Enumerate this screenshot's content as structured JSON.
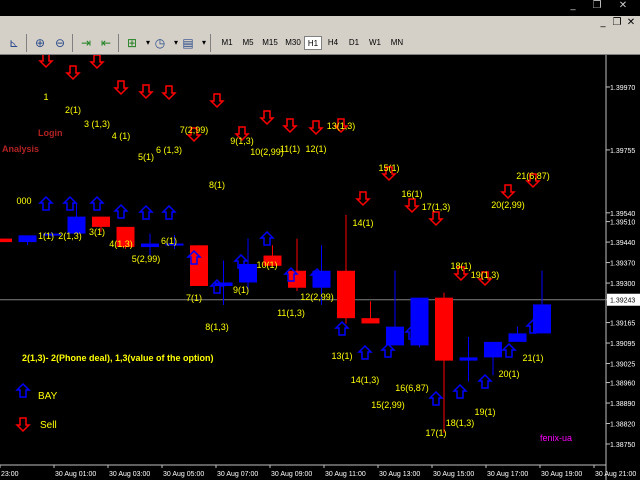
{
  "window_controls": {
    "minimize": "_",
    "restore": "❐",
    "close": "✕"
  },
  "toolbar": {
    "timeframes": [
      "M1",
      "M5",
      "M15",
      "M30",
      "H1",
      "H4",
      "D1",
      "W1",
      "MN"
    ],
    "active_timeframe": "H1"
  },
  "chart_data": {
    "type": "candlestick",
    "colors": {
      "bull": "#0000ff",
      "bear": "#ff0000",
      "up_arrow": "#0000ff",
      "down_arrow": "#ff0000",
      "labels": "#ffff00",
      "grid": "#404040",
      "current_price_line": "#808080"
    },
    "price_axis": {
      "ticks": [
        "1.39970",
        "1.39755",
        "1.39540",
        "1.39510",
        "1.39440",
        "1.39370",
        "1.39300",
        "1.39243",
        "1.39165",
        "1.39095",
        "1.39025",
        "1.38960",
        "1.38890",
        "1.38820",
        "1.38750"
      ],
      "current_price": "1.39243"
    },
    "time_axis": [
      "23:00",
      "30 Aug 01:00",
      "30 Aug 03:00",
      "30 Aug 05:00",
      "30 Aug 07:00",
      "30 Aug 09:00",
      "30 Aug 11:00",
      "30 Aug 13:00",
      "30 Aug 15:00",
      "30 Aug 17:00",
      "30 Aug 19:00",
      "30 Aug 21:00"
    ],
    "candles": [
      {
        "o": 1.39452,
        "h": 1.39452,
        "l": 1.3944,
        "c": 1.3944
      },
      {
        "o": 1.3944,
        "h": 1.39463,
        "l": 1.3943,
        "c": 1.39463
      },
      {
        "o": 1.39463,
        "h": 1.39475,
        "l": 1.39458,
        "c": 1.39469
      },
      {
        "o": 1.39469,
        "h": 1.39573,
        "l": 1.39469,
        "c": 1.39527
      },
      {
        "o": 1.39527,
        "h": 1.39527,
        "l": 1.39475,
        "c": 1.39492
      },
      {
        "o": 1.39492,
        "h": 1.39492,
        "l": 1.39417,
        "c": 1.39423
      },
      {
        "o": 1.39423,
        "h": 1.39469,
        "l": 1.39394,
        "c": 1.39435
      },
      {
        "o": 1.39435,
        "h": 1.39464,
        "l": 1.39417,
        "c": 1.39435
      },
      {
        "o": 1.39429,
        "h": 1.39429,
        "l": 1.3929,
        "c": 1.3929
      },
      {
        "o": 1.3929,
        "h": 1.39377,
        "l": 1.39226,
        "c": 1.39302
      },
      {
        "o": 1.39302,
        "h": 1.39452,
        "l": 1.39267,
        "c": 1.39365
      },
      {
        "o": 1.39394,
        "h": 1.39429,
        "l": 1.39365,
        "c": 1.39359
      },
      {
        "o": 1.39342,
        "h": 1.39452,
        "l": 1.39273,
        "c": 1.39284
      },
      {
        "o": 1.39284,
        "h": 1.39429,
        "l": 1.39226,
        "c": 1.39342
      },
      {
        "o": 1.39342,
        "h": 1.39533,
        "l": 1.39162,
        "c": 1.3918
      },
      {
        "o": 1.3918,
        "h": 1.39238,
        "l": 1.39162,
        "c": 1.39162
      },
      {
        "o": 1.39087,
        "h": 1.39342,
        "l": 1.39087,
        "c": 1.39151
      },
      {
        "o": 1.39087,
        "h": 1.3925,
        "l": 1.3908,
        "c": 1.3925
      },
      {
        "o": 1.3925,
        "h": 1.39267,
        "l": 1.38788,
        "c": 1.39035
      },
      {
        "o": 1.39035,
        "h": 1.39116,
        "l": 1.38963,
        "c": 1.39046
      },
      {
        "o": 1.39046,
        "h": 1.39087,
        "l": 1.38985,
        "c": 1.39099
      },
      {
        "o": 1.39099,
        "h": 1.39151,
        "l": 1.39099,
        "c": 1.39128
      },
      {
        "o": 1.39128,
        "h": 1.39342,
        "l": 1.39128,
        "c": 1.39227
      }
    ],
    "signals": [
      {
        "label": "1",
        "dir": "down",
        "ci": 2
      },
      {
        "label": "2(1)",
        "dir": "down",
        "ci": 3
      },
      {
        "label": "3 (1,3)",
        "dir": "down",
        "ci": 4
      },
      {
        "label": "4 (1)",
        "dir": "down",
        "ci": 5
      },
      {
        "label": "5(1)",
        "dir": "down",
        "ci": 6
      },
      {
        "label": "6 (1,3)",
        "dir": "down",
        "ci": 7
      },
      {
        "label": "7(2,99)",
        "dir": "down",
        "ci": 8
      },
      {
        "label": "8(1)",
        "dir": "down",
        "ci": 9
      },
      {
        "label": "9(1,3)",
        "dir": "down",
        "ci": 10
      },
      {
        "label": "10(2,99)",
        "dir": "down",
        "ci": 11
      },
      {
        "label": "11(1)",
        "dir": "down",
        "ci": 12
      },
      {
        "label": "12(1)",
        "dir": "down",
        "ci": 13
      },
      {
        "label": "13(1,3)",
        "dir": "down",
        "ci": 14
      },
      {
        "label": "14(1)",
        "dir": "down",
        "ci": 15
      },
      {
        "label": "15(1)",
        "dir": "down",
        "ci": 16
      },
      {
        "label": "16(1)",
        "dir": "down",
        "ci": 17
      },
      {
        "label": "17(1,3)",
        "dir": "down",
        "ci": 18
      },
      {
        "label": "18(1)",
        "dir": "down",
        "ci": 19
      },
      {
        "label": "19(1,3)",
        "dir": "down",
        "ci": 20
      },
      {
        "label": "20(2,99)",
        "dir": "down",
        "ci": 21
      },
      {
        "label": "21(6,87)",
        "dir": "down",
        "ci": 22
      },
      {
        "label": "000",
        "dir": "none",
        "ci": 1
      },
      {
        "label": "1(1)",
        "dir": "up",
        "ci": 2
      },
      {
        "label": "2(1,3)",
        "dir": "up",
        "ci": 3
      },
      {
        "label": "3(1)",
        "dir": "up",
        "ci": 4
      },
      {
        "label": "4(1,3)",
        "dir": "up",
        "ci": 5
      },
      {
        "label": "5(2,99)",
        "dir": "up",
        "ci": 6
      },
      {
        "label": "6(1)",
        "dir": "up",
        "ci": 7
      },
      {
        "label": "7(1)",
        "dir": "up",
        "ci": 8
      },
      {
        "label": "8(1,3)",
        "dir": "up",
        "ci": 9
      },
      {
        "label": "9(1)",
        "dir": "up",
        "ci": 10
      },
      {
        "label": "10(1)",
        "dir": "up",
        "ci": 11
      },
      {
        "label": "11(1,3)",
        "dir": "up",
        "ci": 12
      },
      {
        "label": "12(2,99)",
        "dir": "up",
        "ci": 13
      },
      {
        "label": "13(1)",
        "dir": "up",
        "ci": 14
      },
      {
        "label": "14(1,3)",
        "dir": "up",
        "ci": 15
      },
      {
        "label": "15(2,99)",
        "dir": "up",
        "ci": 16
      },
      {
        "label": "16(6,87)",
        "dir": "up",
        "ci": 17
      },
      {
        "label": "17(1)",
        "dir": "up",
        "ci": 18
      },
      {
        "label": "18(1,3)",
        "dir": "up",
        "ci": 19
      },
      {
        "label": "19(1)",
        "dir": "up",
        "ci": 20
      },
      {
        "label": "20(1)",
        "dir": "up",
        "ci": 21
      },
      {
        "label": "21(1)",
        "dir": "up",
        "ci": 22
      }
    ],
    "annotations": {
      "login": "Login",
      "analysis": "Analysis",
      "explanation": "2(1,3)-    2(Phone deal),  1,3(value of the option)",
      "legend_buy": "BAY",
      "legend_sell": "Sell",
      "watermark": "fenix-ua"
    }
  }
}
